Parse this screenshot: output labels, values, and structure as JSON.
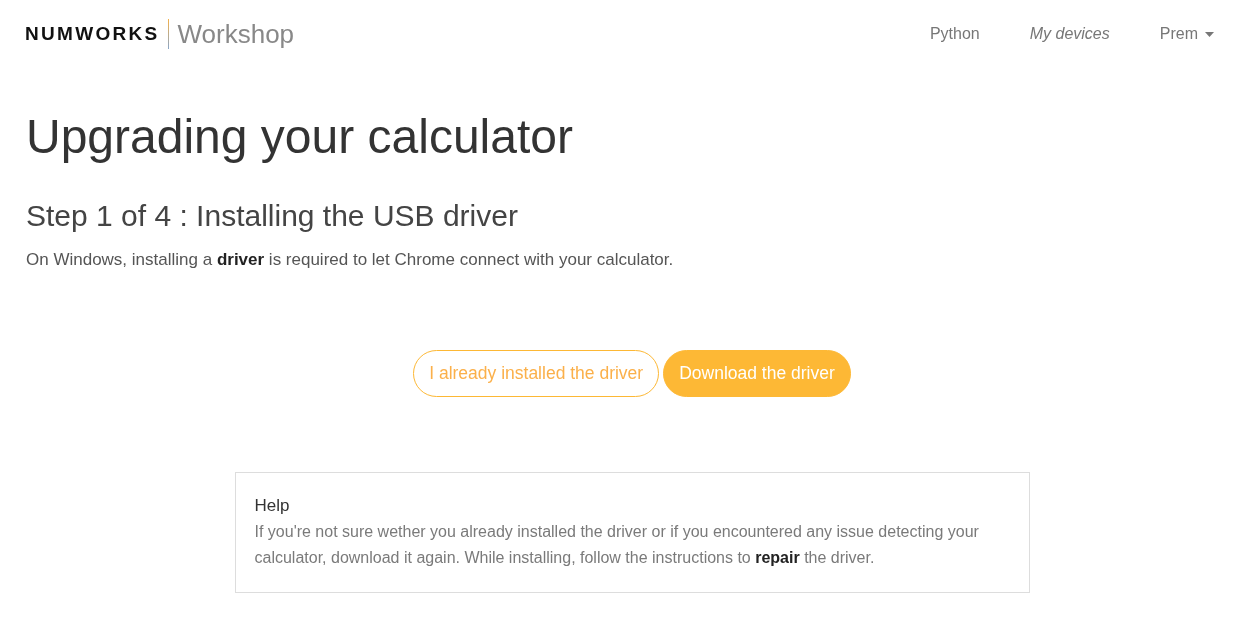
{
  "header": {
    "logo": {
      "brand": "NUMWORKS",
      "product": "Workshop"
    },
    "nav": [
      {
        "label": "Python",
        "selected": false,
        "kind": "link"
      },
      {
        "label": "My devices",
        "selected": true,
        "kind": "link"
      },
      {
        "label": "Prem",
        "selected": false,
        "kind": "dropdown"
      }
    ]
  },
  "page": {
    "title": "Upgrading your calculator",
    "step_heading": "Step 1 of 4 : Installing the USB driver",
    "description": "On Windows, installing a **driver** is required to let Chrome connect with your calculator."
  },
  "actions": [
    {
      "label": "I already installed the driver",
      "kind": "outline"
    },
    {
      "label": "Download the driver",
      "kind": "filled"
    }
  ],
  "help": {
    "title": "Help",
    "text": "If you're not sure wether you already installed the driver or if you encountered any issue detecting your calculator, download it again. While installing, follow the instructions to **repair** the driver."
  }
}
